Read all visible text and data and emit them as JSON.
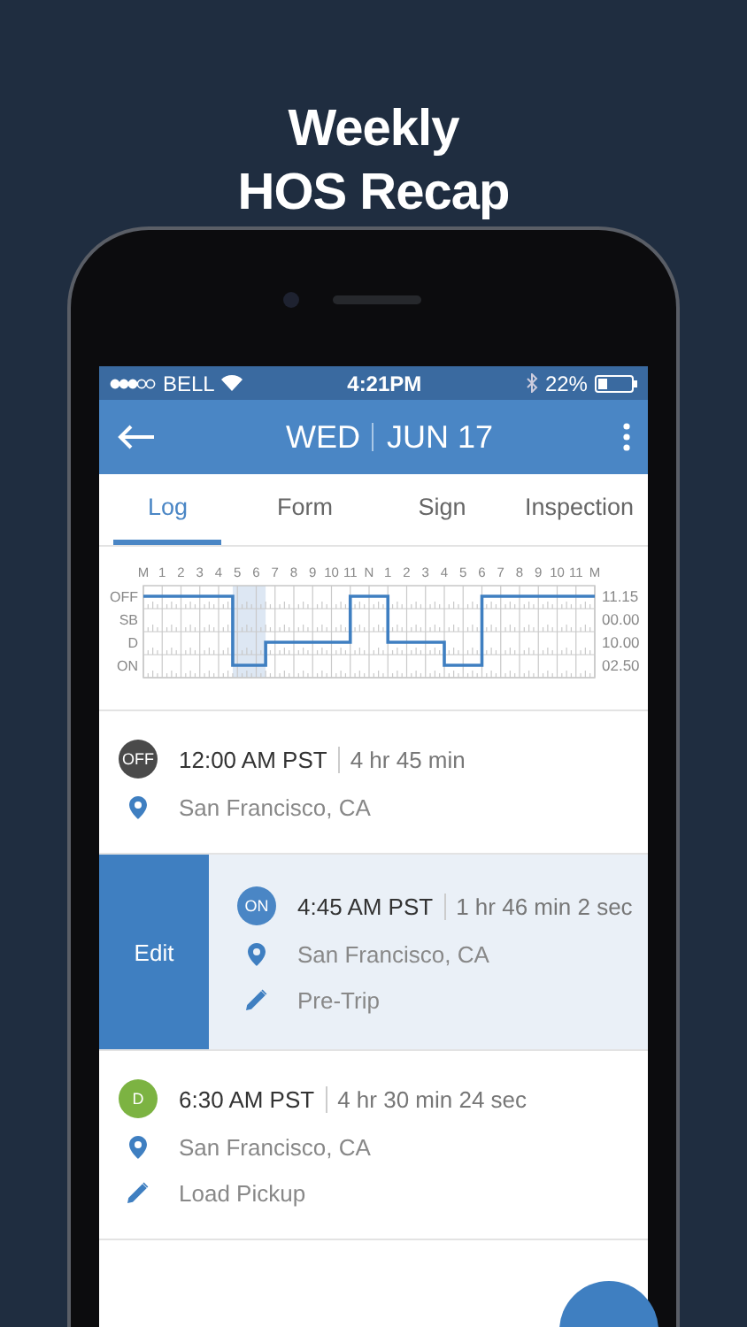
{
  "headline": [
    "Weekly",
    "HOS Recap"
  ],
  "status_bar": {
    "carrier": "BELL",
    "time": "4:21PM",
    "battery": "22%"
  },
  "header": {
    "day": "WED",
    "date": "JUN 17"
  },
  "tabs": [
    {
      "label": "Log",
      "selected": true
    },
    {
      "label": "Form",
      "selected": false
    },
    {
      "label": "Sign",
      "selected": false
    },
    {
      "label": "Inspection",
      "selected": false
    }
  ],
  "duty_log": {
    "hour_labels": [
      "M",
      "1",
      "2",
      "3",
      "4",
      "5",
      "6",
      "7",
      "8",
      "9",
      "10",
      "11",
      "N",
      "1",
      "2",
      "3",
      "4",
      "5",
      "6",
      "7",
      "8",
      "9",
      "10",
      "11",
      "M"
    ],
    "rows": [
      {
        "label": "OFF",
        "total": "11.15"
      },
      {
        "label": "SB",
        "total": "00.00"
      },
      {
        "label": "D",
        "total": "10.00"
      },
      {
        "label": "ON",
        "total": "02.50"
      }
    ]
  },
  "entries": [
    {
      "badge": "OFF",
      "color": "#4a4a4a",
      "time": "12:00 AM PST",
      "duration": "4 hr 45 min",
      "location": "San Francisco, CA",
      "selected": false
    },
    {
      "badge": "ON",
      "color": "#4a86c5",
      "time": "4:45 AM PST",
      "duration": "1 hr 46 min 2 sec",
      "location": "San Francisco, CA",
      "note": "Pre-Trip",
      "selected": true,
      "action": "Edit"
    },
    {
      "badge": "D",
      "color": "#7cb342",
      "time": "6:30 AM PST",
      "duration": "4 hr 30 min 24 sec",
      "location": "San Francisco, CA",
      "note": "Load Pickup",
      "selected": false
    }
  ]
}
